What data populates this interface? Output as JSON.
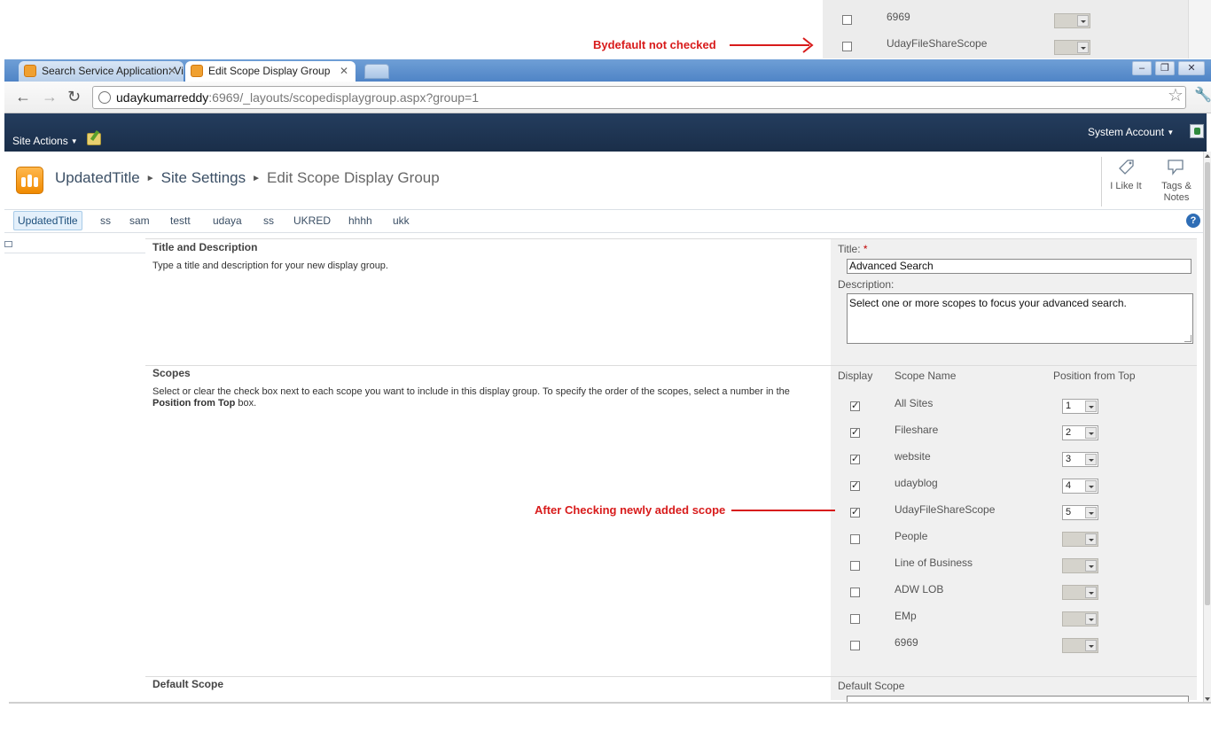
{
  "snippet": {
    "rows": [
      {
        "name": "6969",
        "checked": false
      },
      {
        "name": "UdayFileShareScope",
        "checked": false
      }
    ]
  },
  "annotations": {
    "top": "Bydefault not checked",
    "middle": "After Checking newly added scope"
  },
  "browser": {
    "tabs": [
      {
        "label": "Search Service Application: Vi",
        "active": false
      },
      {
        "label": "Edit Scope Display Group",
        "active": true
      }
    ],
    "url_host": "udaykumarreddy",
    "url_rest": ":6969/_layouts/scopedisplaygroup.aspx?group=1"
  },
  "ribbon": {
    "site_actions": "Site Actions",
    "user": "System Account"
  },
  "header": {
    "breadcrumb": [
      "UpdatedTitle",
      "Site Settings",
      "Edit Scope Display Group"
    ],
    "i_like_it": "I Like It",
    "tags_notes_1": "Tags &",
    "tags_notes_2": "Notes"
  },
  "topnav": [
    "UpdatedTitle",
    "ss",
    "sam",
    "testt",
    "udaya",
    "ss",
    "UKRED",
    "hhhh",
    "ukk"
  ],
  "sections": {
    "title_desc": {
      "title": "Title and Description",
      "desc": "Type a title and description for your new display group.",
      "title_label": "Title:",
      "required_mark": "*",
      "title_value": "Advanced Search",
      "desc_label": "Description:",
      "desc_value": "Select one or more scopes to focus your advanced search."
    },
    "scopes": {
      "title": "Scopes",
      "desc_pre": "Select or clear the check box next to each scope you want to include in this display group. To specify the order of the scopes, select a number in the ",
      "desc_bold": "Position from Top",
      "desc_post": " box.",
      "col_display": "Display",
      "col_name": "Scope Name",
      "col_position": "Position from Top",
      "rows": [
        {
          "name": "All Sites",
          "checked": true,
          "position": "1"
        },
        {
          "name": "Fileshare",
          "checked": true,
          "position": "2"
        },
        {
          "name": "website",
          "checked": true,
          "position": "3"
        },
        {
          "name": "udayblog",
          "checked": true,
          "position": "4"
        },
        {
          "name": "UdayFileShareScope",
          "checked": true,
          "position": "5"
        },
        {
          "name": "People",
          "checked": false,
          "position": ""
        },
        {
          "name": "Line of Business",
          "checked": false,
          "position": ""
        },
        {
          "name": "ADW LOB",
          "checked": false,
          "position": ""
        },
        {
          "name": "EMp",
          "checked": false,
          "position": ""
        },
        {
          "name": "6969",
          "checked": false,
          "position": ""
        }
      ]
    },
    "default_scope": {
      "title": "Default Scope",
      "label": "Default Scope"
    }
  },
  "colors": {
    "annotation": "#d81b1b",
    "ribbon": "#1f3553",
    "link": "#3b4f65"
  }
}
